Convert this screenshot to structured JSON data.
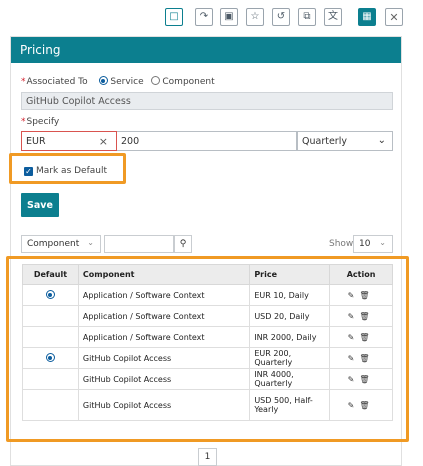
{
  "toolbar": {
    "icons": [
      "document-icon",
      "document-arrow-icon",
      "image-icon",
      "star-list-icon",
      "history-icon",
      "copy-icon",
      "translate-icon",
      "save-icon",
      "close-icon"
    ],
    "close_label": "✕"
  },
  "panel": {
    "title": "Pricing"
  },
  "form": {
    "associated_to_label": "Associated To",
    "radio_options": [
      "Service",
      "Component"
    ],
    "selected_radio": "Service",
    "associated_value": "GitHub Copilot Access",
    "specify_label": "Specify",
    "currency_value": "EUR",
    "amount_value": "200",
    "frequency_value": "Quarterly",
    "mark_default_label": "Mark as Default",
    "mark_default_checked": true,
    "save_label": "Save"
  },
  "filter": {
    "type_select": "Component",
    "search_value": "",
    "show_label": "Show",
    "page_size": "10"
  },
  "table": {
    "columns": [
      "Default",
      "Component",
      "Price",
      "Action"
    ],
    "rows": [
      {
        "default": true,
        "component": "Application / Software Context",
        "price": "EUR 10, Daily"
      },
      {
        "default": false,
        "component": "Application / Software Context",
        "price": "USD 20, Daily"
      },
      {
        "default": false,
        "component": "Application / Software Context",
        "price": "INR 2000, Daily"
      },
      {
        "default": true,
        "component": "GitHub Copilot Access",
        "price": "EUR 200, Quarterly"
      },
      {
        "default": false,
        "component": "GitHub Copilot Access",
        "price": "INR 4000, Quarterly"
      },
      {
        "default": false,
        "component": "GitHub Copilot Access",
        "price": "USD 500, Half-Yearly"
      }
    ]
  },
  "pagination": {
    "current_page": "1"
  },
  "colors": {
    "teal": "#0c7f8f",
    "highlight": "#f09a24",
    "error": "#d9534f"
  }
}
